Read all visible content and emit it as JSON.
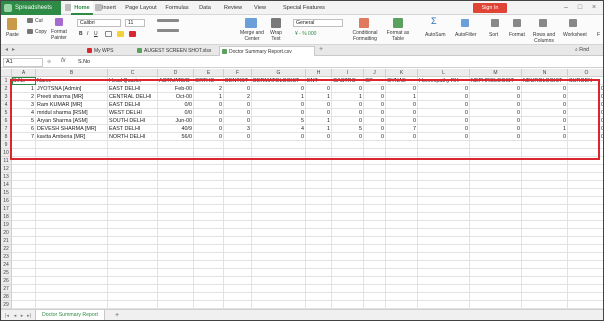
{
  "app": {
    "title": "Spreadsheets",
    "ribbon_tabs": [
      "Home",
      "Insert",
      "Page Layout",
      "Formulas",
      "Data",
      "Review",
      "View",
      "Special Features"
    ],
    "active_tab": "Home",
    "sign_in": "Sign In"
  },
  "toolbar": {
    "paste": "Paste",
    "cut": "Cut",
    "copy": "Copy",
    "format_painter": "Format Painter",
    "font_name": "Calibri",
    "font_size": "11",
    "merge_center": "Merge and Center",
    "wrap_text": "Wrap Text",
    "number_format": "General",
    "conditional_formatting": "Conditional Formatting",
    "format_as_table": "Format as Table",
    "autosum": "AutoSum",
    "autofilter": "AutoFilter",
    "sort": "Sort",
    "format": "Format",
    "rows_columns": "Rows and Columns",
    "worksheet": "Worksheet",
    "freeze": "F"
  },
  "doc_tabs": [
    "My WPS",
    "AUGEST SCREEN SHOT.xlsx",
    "Doctor Summary Report.csv"
  ],
  "find": "Find",
  "formula_bar": {
    "cell_ref": "A1",
    "fx": "fx",
    "value": "S.No"
  },
  "grid": {
    "columns": [
      "A",
      "B",
      "C",
      "D",
      "E",
      "F",
      "G",
      "H",
      "I",
      "J",
      "K",
      "L",
      "M",
      "N",
      "O"
    ],
    "row_numbers": [
      "1",
      "2",
      "3",
      "4",
      "5",
      "6",
      "7",
      "8",
      "9",
      "10",
      "11",
      "12",
      "13",
      "14",
      "15",
      "16",
      "17",
      "18",
      "19",
      "20",
      "21",
      "22",
      "23",
      "24",
      "25",
      "26",
      "27",
      "28",
      "29"
    ],
    "header": [
      "S.No",
      "Name",
      "Head Quarter",
      "ACTIVATE/D",
      "ORTHO",
      "DENTIST",
      "DERMATOLOGIST",
      "ENT",
      "GASTRO",
      "GP",
      "GYNAE",
      "Homeopathy RK",
      "NEPHROLOGIST",
      "NEUROLOGIST",
      "SURGEN"
    ],
    "rows": [
      [
        "1",
        "JYOTSNA [Admin]",
        "EAST DELHI",
        "Feb-00",
        "2",
        "0",
        "0",
        "0",
        "0",
        "0",
        "0",
        "0",
        "0",
        "0",
        "0"
      ],
      [
        "2",
        "Preeti sharma [MR]",
        "CENTRAL DELHI",
        "Oct-00",
        "1",
        "2",
        "1",
        "1",
        "1",
        "0",
        "1",
        "0",
        "0",
        "0",
        "0"
      ],
      [
        "3",
        "Ram KUMAR [MR]",
        "EAST DELHI",
        "0/0",
        "0",
        "0",
        "0",
        "0",
        "0",
        "0",
        "0",
        "0",
        "0",
        "0",
        "0"
      ],
      [
        "4",
        "mridul sharma [RSM]",
        "WEST DELHI",
        "0/0",
        "0",
        "0",
        "0",
        "0",
        "0",
        "0",
        "0",
        "0",
        "0",
        "0",
        "0"
      ],
      [
        "5",
        "Aryan Sharma [ASM]",
        "SOUTH DELHI",
        "Jun-00",
        "0",
        "0",
        "5",
        "1",
        "0",
        "0",
        "0",
        "0",
        "0",
        "0",
        "0"
      ],
      [
        "6",
        "DEVESH SHARMA [MR]",
        "EAST DELHI",
        "40/9",
        "0",
        "3",
        "4",
        "1",
        "5",
        "0",
        "7",
        "0",
        "0",
        "1",
        "0"
      ],
      [
        "7",
        "kavita Amberia [MR]",
        "NORTH DELHI",
        "56/0",
        "0",
        "0",
        "0",
        "0",
        "0",
        "0",
        "0",
        "0",
        "0",
        "0",
        "0"
      ]
    ]
  },
  "sheet_tab": "Doctor Summary Report"
}
